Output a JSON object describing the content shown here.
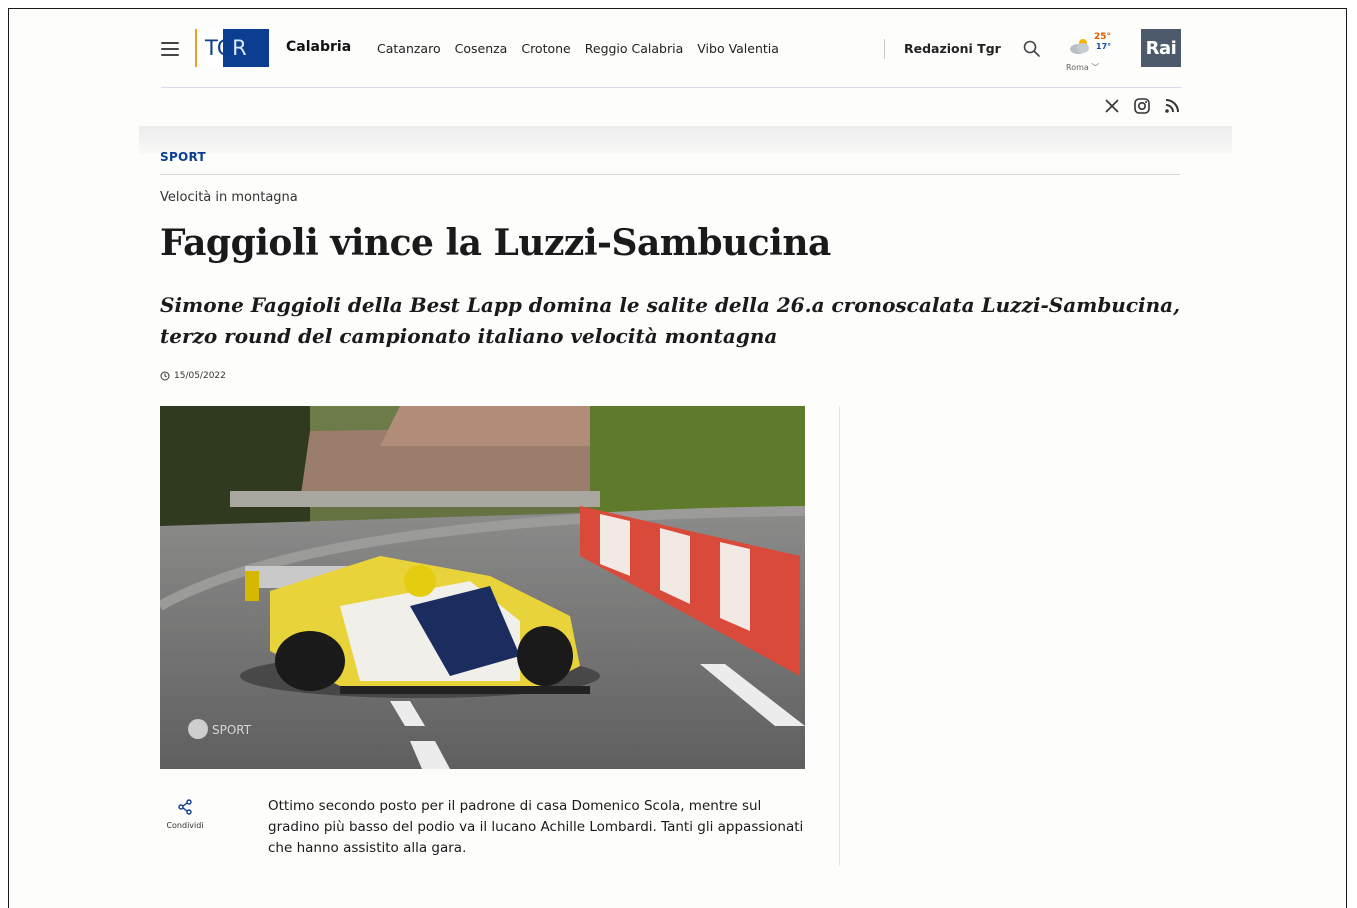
{
  "header": {
    "brand": "TGR",
    "region": "Calabria",
    "cities": [
      "Catanzaro",
      "Cosenza",
      "Crotone",
      "Reggio Calabria",
      "Vibo Valentia"
    ],
    "redazioni": "Redazioni Tgr",
    "weather": {
      "high": "25°",
      "low": "17°",
      "city": "Roma",
      "icon": "partly-cloudy-icon"
    },
    "rai": "Rai"
  },
  "social": [
    "x-icon",
    "instagram-icon",
    "rss-icon"
  ],
  "article": {
    "section": "SPORT",
    "kicker": "Velocità in montagna",
    "title": "Faggioli vince la Luzzi-Sambucina",
    "subtitle": "Simone Faggioli della Best Lapp domina le salite della 26.a cronoscalata Luzzi-Sambucina, terzo round del campionato italiano velocità montagna",
    "date": "15/05/2022",
    "photo_watermark": "SPORT",
    "share_label": "Condividi",
    "body": "Ottimo secondo posto per il padrone di casa Domenico Scola, mentre sul gradino più basso del podio va il lucano Achille Lombardi. Tanti gli appassionati che hanno assistito alla gara."
  }
}
